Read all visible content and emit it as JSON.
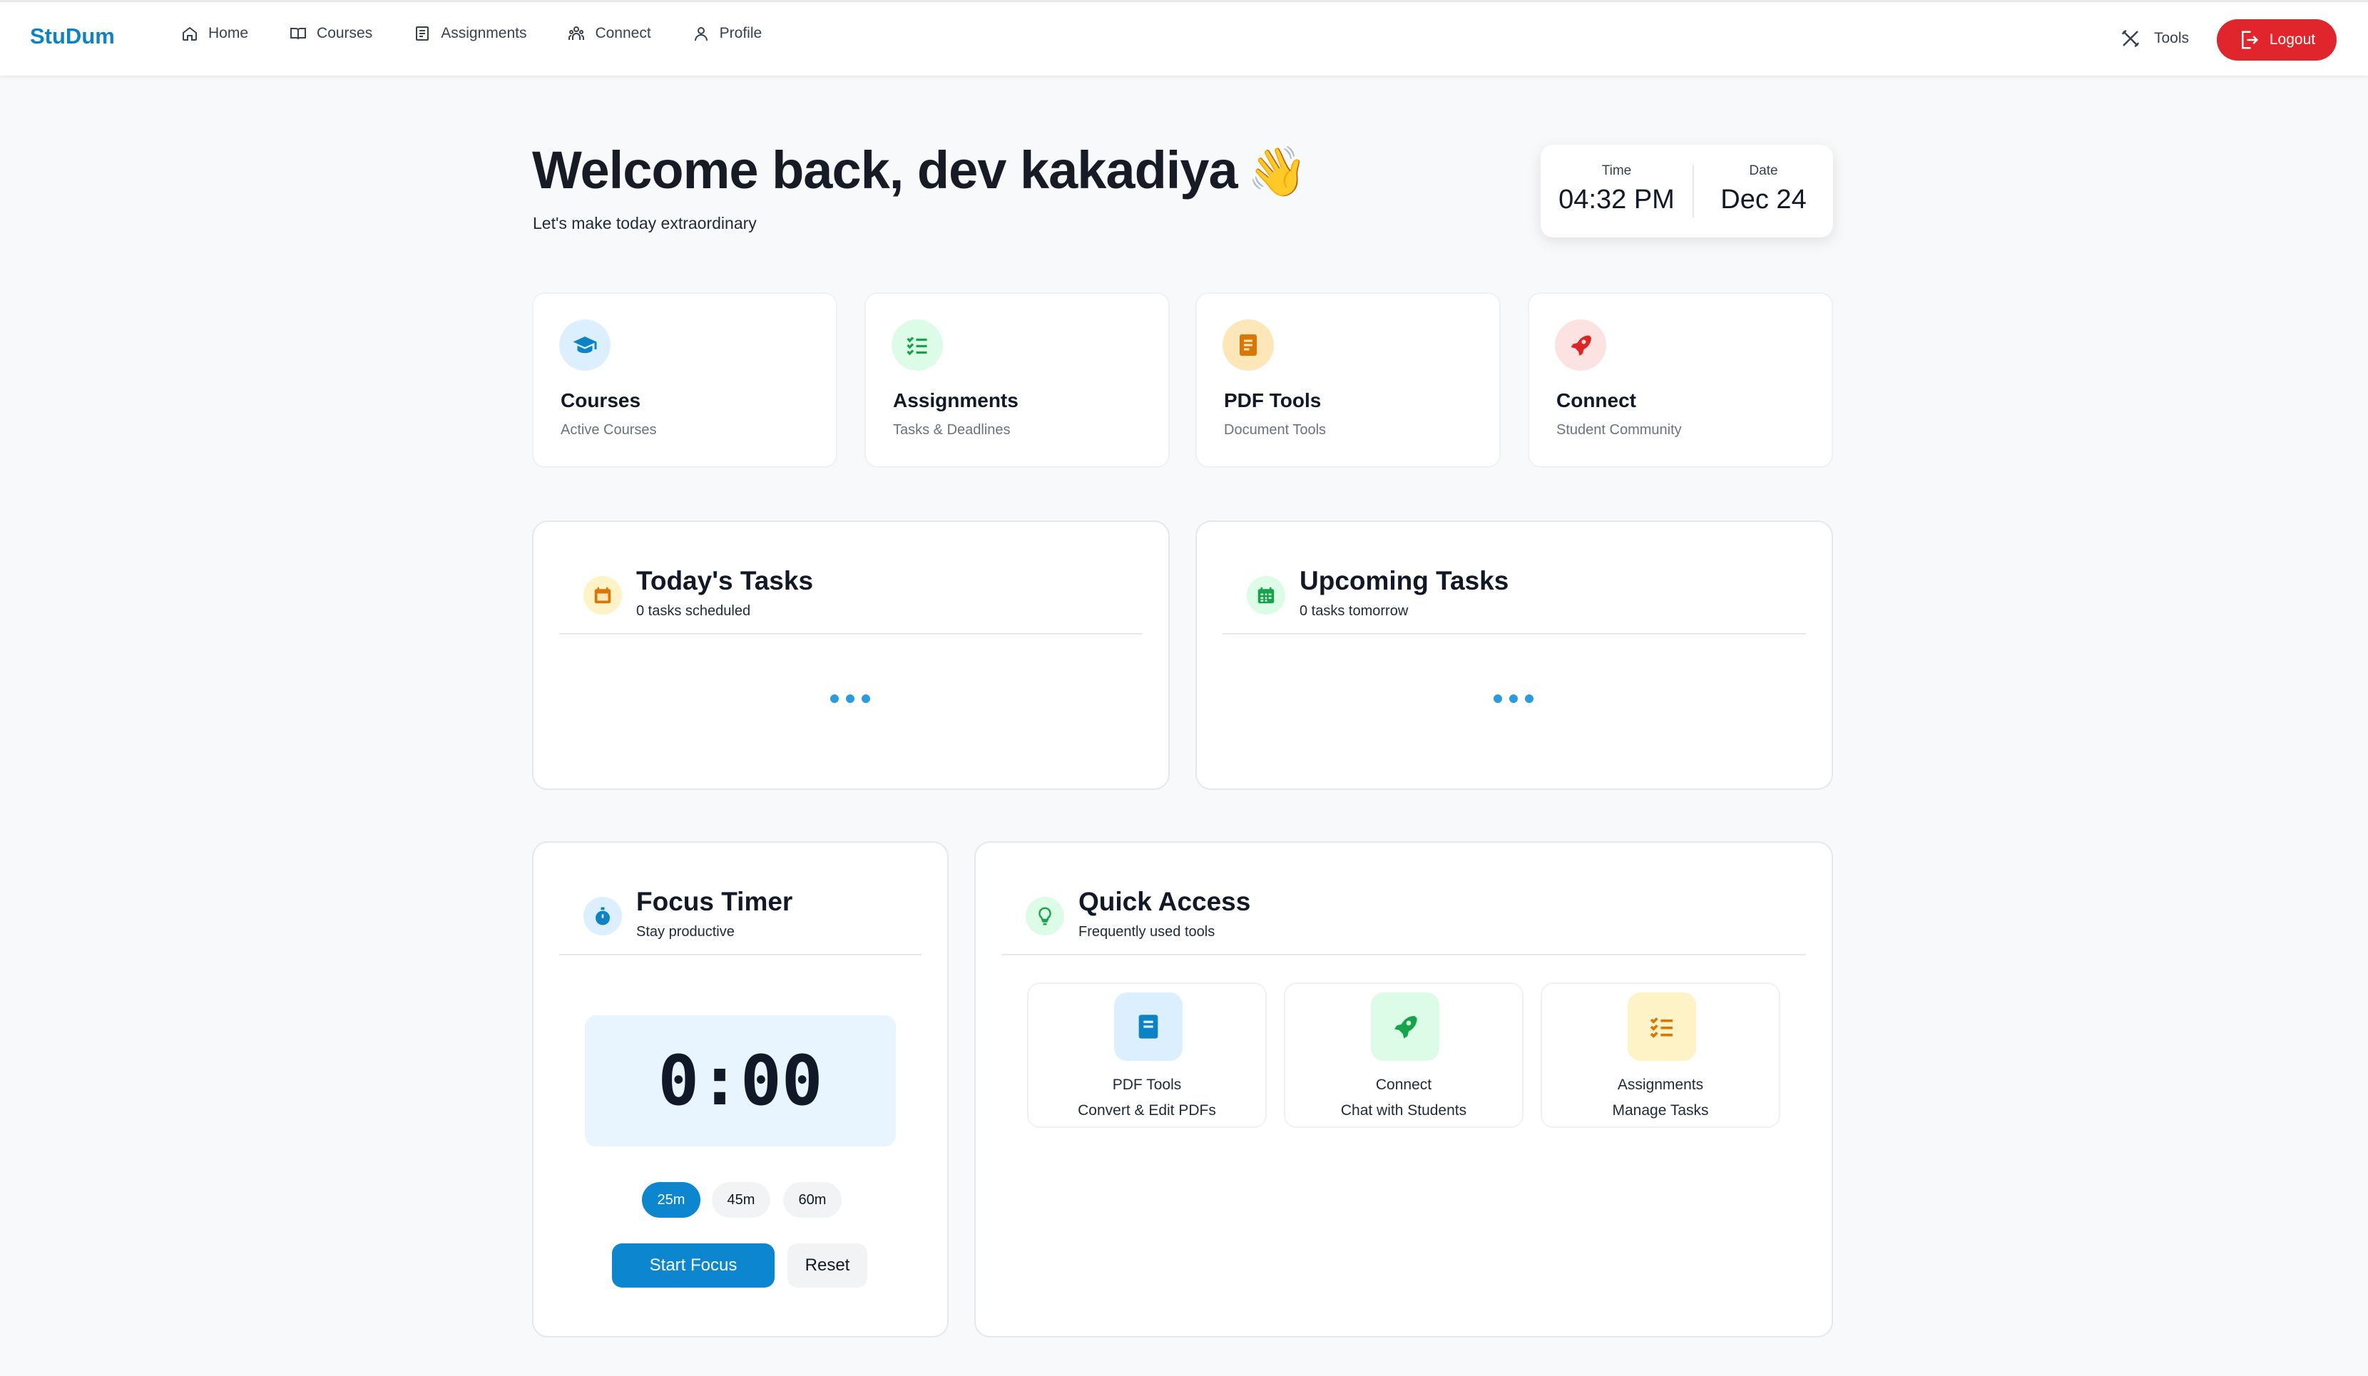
{
  "nav": {
    "brand": "StuDum",
    "links": [
      {
        "label": "Home",
        "icon": "home-icon"
      },
      {
        "label": "Courses",
        "icon": "book-icon"
      },
      {
        "label": "Assignments",
        "icon": "document-icon"
      },
      {
        "label": "Connect",
        "icon": "users-icon"
      },
      {
        "label": "Profile",
        "icon": "user-icon"
      }
    ],
    "tools_label": "Tools",
    "logout_label": "Logout",
    "logout_color": "#e0262c"
  },
  "header": {
    "welcome": "Welcome back, dev kakadiya",
    "wave_emoji": "👋",
    "subtitle": "Let's make today extraordinary",
    "time_label": "Time",
    "time_value": "04:32 PM",
    "date_label": "Date",
    "date_value": "Dec 24"
  },
  "stats": [
    {
      "title": "Courses",
      "subtitle": "Active Courses",
      "icon": "graduation-cap-icon",
      "color": "#0d83c6"
    },
    {
      "title": "Assignments",
      "subtitle": "Tasks & Deadlines",
      "icon": "checklist-icon",
      "color": "#16a34a"
    },
    {
      "title": "PDF Tools",
      "subtitle": "Document Tools",
      "icon": "document-icon",
      "color": "#d97706"
    },
    {
      "title": "Connect",
      "subtitle": "Student Community",
      "icon": "rocket-icon",
      "color": "#dc2626"
    }
  ],
  "today_tasks": {
    "title": "Today's Tasks",
    "subtitle": "0 tasks scheduled",
    "icon": "calendar-icon"
  },
  "upcoming_tasks": {
    "title": "Upcoming Tasks",
    "subtitle": "0 tasks tomorrow",
    "icon": "calendar-grid-icon"
  },
  "focus_timer": {
    "title": "Focus Timer",
    "subtitle": "Stay productive",
    "icon": "stopwatch-icon",
    "time": "0:00",
    "durations": [
      "25m",
      "45m",
      "60m"
    ],
    "selected_duration": "25m",
    "start_label": "Start Focus",
    "reset_label": "Reset"
  },
  "quick_access": {
    "title": "Quick Access",
    "subtitle": "Frequently used tools",
    "icon": "lightbulb-icon",
    "items": [
      {
        "title": "PDF Tools",
        "subtitle": "Convert & Edit PDFs",
        "icon": "book-icon",
        "color": "#0d83c6"
      },
      {
        "title": "Connect",
        "subtitle": "Chat with Students",
        "icon": "rocket-icon",
        "color": "#16a34a"
      },
      {
        "title": "Assignments",
        "subtitle": "Manage Tasks",
        "icon": "checklist-icon",
        "color": "#d97706"
      }
    ]
  }
}
